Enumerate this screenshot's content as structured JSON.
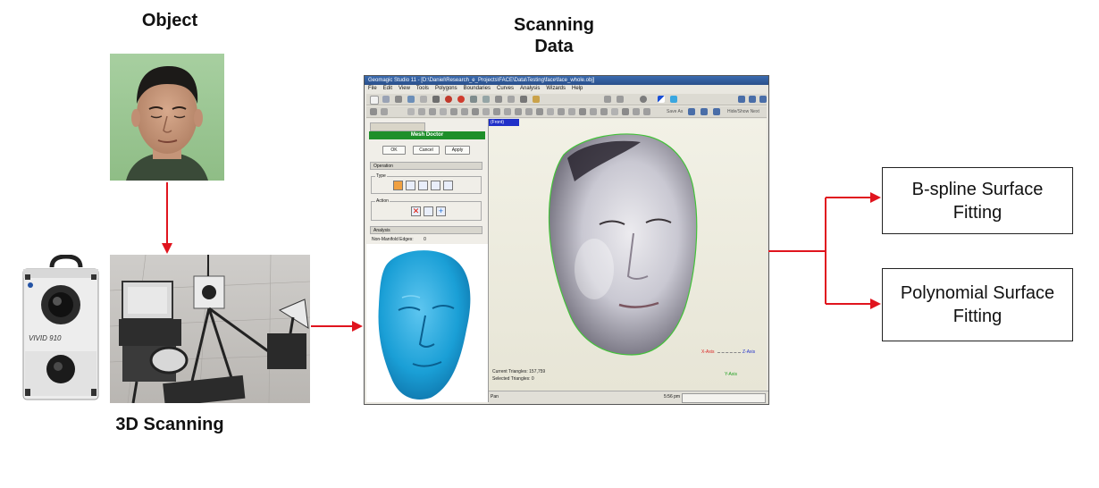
{
  "labels": {
    "object": "Object",
    "scanning_data": "Scanning\nData",
    "scanning_3d": "3D Scanning"
  },
  "results": [
    {
      "text": "B-spline Surface\nFitting"
    },
    {
      "text": "Polynomial Surface\nFitting"
    }
  ],
  "scanner_brand": "VIVID 910",
  "software": {
    "title": "Geomagic Studio 11 - [D:\\Daniel\\Research_e_Projects\\FACE\\Data\\Testing\\face\\face_whole.obj]",
    "menu": [
      "File",
      "Edit",
      "View",
      "Tools",
      "Polygons",
      "Boundaries",
      "Curves",
      "Analysis",
      "Wizards",
      "Help"
    ],
    "toolbar_text_1": "Save As",
    "toolbar_text_2": "Hide/Show Next",
    "panel_title": "Mesh Doctor",
    "buttons": {
      "ok": "OK",
      "cancel": "Cancel",
      "apply": "Apply"
    },
    "sections": {
      "operation": "Operation",
      "type": "Type",
      "action": "Action",
      "analysis": "Analysis"
    },
    "non_manifold": {
      "label": "Non-Manifold Edges:",
      "value": "0"
    },
    "view_tag": "(Front)",
    "current_triangles": "Current Triangles: 157,759",
    "selected_triangles": "Selected Triangles: 0",
    "axes": {
      "x": "X-Axis",
      "y": "Y-Axis",
      "z": "Z-Axis"
    },
    "status_left": "Pan",
    "status_time": "5:56 pm"
  },
  "colors": {
    "arrow": "#e0141e",
    "panel_green": "#1e8f2a",
    "mesh_blue": "#1a9fd6",
    "view_tag": "#2030c8"
  }
}
